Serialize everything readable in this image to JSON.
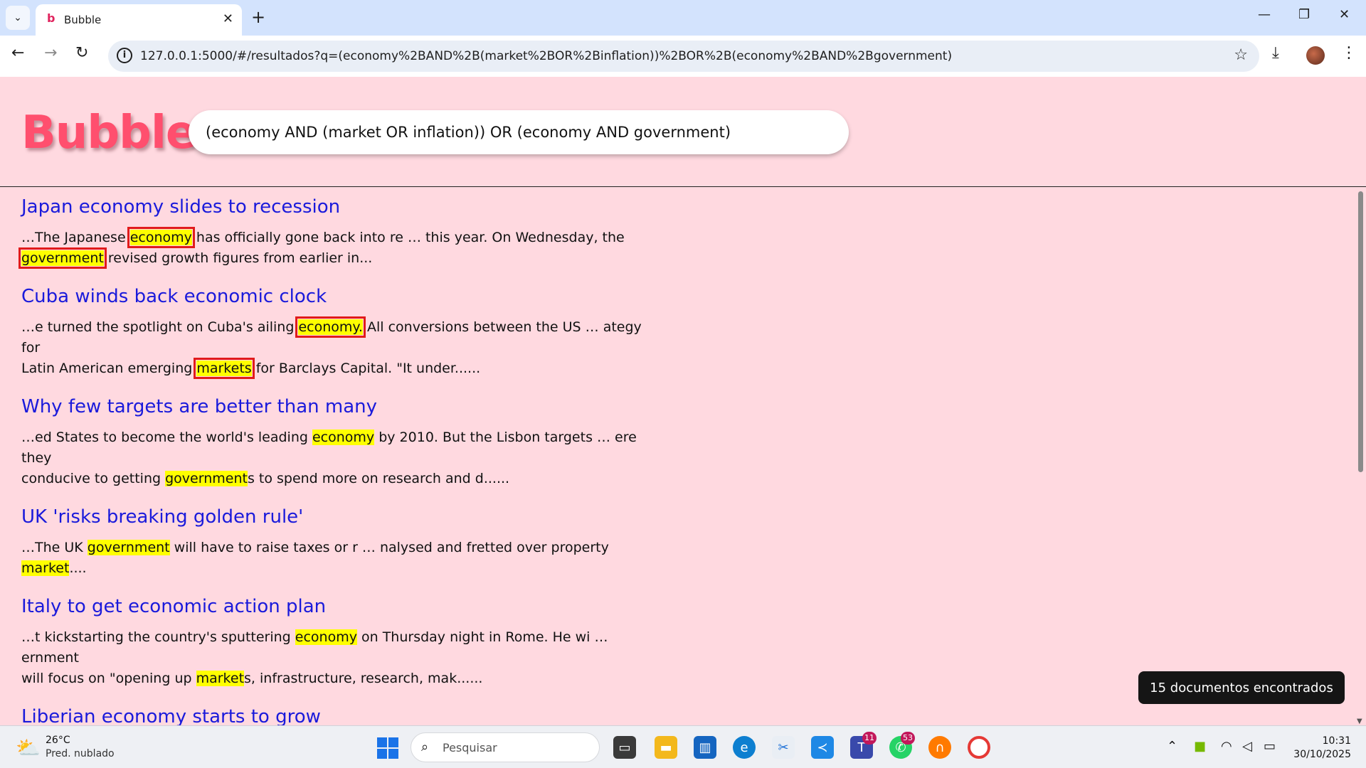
{
  "browser": {
    "tab_title": "Bubble",
    "tab_favicon": "b",
    "new_tab": "+",
    "url": "127.0.0.1:5000/#/resultados?q=(economy%2BAND%2B(market%2BOR%2Binflation))%2BOR%2B(economy%2BAND%2Bgovernment)"
  },
  "app": {
    "logo": "Bubble",
    "query": "(economy AND (market OR inflation)) OR (economy AND government)"
  },
  "results": [
    {
      "title": "Japan economy slides to recession",
      "line1": [
        [
          "…The Japanese ",
          ""
        ],
        [
          "economy",
          "hl boxed"
        ],
        [
          " has officially gone back into re … this year. On Wednesday, the",
          ""
        ]
      ],
      "line2": [
        [
          "government",
          "hl boxed"
        ],
        [
          " revised growth figures from earlier in...",
          ""
        ]
      ]
    },
    {
      "title": "Cuba winds back economic clock",
      "line1": [
        [
          "…e turned the spotlight on Cuba's ailing ",
          ""
        ],
        [
          "economy.",
          "hl boxed"
        ],
        [
          " All conversions between the US … ategy for",
          ""
        ]
      ],
      "line2": [
        [
          "Latin American emerging ",
          ""
        ],
        [
          "markets",
          "hl boxed"
        ],
        [
          " for Barclays Capital. \"It under......",
          ""
        ]
      ]
    },
    {
      "title": "Why few targets are better than many",
      "line1": [
        [
          "…ed States to become the world's leading ",
          ""
        ],
        [
          "economy",
          "hl"
        ],
        [
          " by 2010. But the Lisbon targets … ere they",
          ""
        ]
      ],
      "line2": [
        [
          "conducive to getting ",
          ""
        ],
        [
          "government",
          "hl"
        ],
        [
          "s to spend more on research and d......",
          ""
        ]
      ]
    },
    {
      "title": "UK 'risks breaking golden rule'",
      "line1": [
        [
          "…The UK ",
          ""
        ],
        [
          "government",
          "hl"
        ],
        [
          " will have to raise taxes or r … nalysed and fretted over property ",
          ""
        ],
        [
          "market",
          "hl"
        ],
        [
          "....",
          ""
        ]
      ],
      "line2": []
    },
    {
      "title": "Italy to get economic action plan",
      "line1": [
        [
          "…t kickstarting the country's sputtering ",
          ""
        ],
        [
          "economy",
          "hl"
        ],
        [
          " on Thursday night in Rome. He wi … ernment",
          ""
        ]
      ],
      "line2": [
        [
          "will focus on \"opening up ",
          ""
        ],
        [
          "market",
          "hl"
        ],
        [
          "s, infrastructure, research, mak......",
          ""
        ]
      ]
    },
    {
      "title": "Liberian economy starts to grow",
      "line1": [],
      "line2": []
    }
  ],
  "count_badge": "15 documentos encontrados",
  "taskbar": {
    "weather_temp": "26°C",
    "weather_desc": "Pred. nublado",
    "search_placeholder": "Pesquisar",
    "teams_badge": "11",
    "whatsapp_badge": "53",
    "time": "10:31",
    "date": "30/10/2025"
  },
  "colors": {
    "page_bg": "#ffd9e0",
    "logo": "#ff4f6e",
    "link": "#1a1adb",
    "highlight": "#ffff00",
    "box": "#e11b1b"
  }
}
